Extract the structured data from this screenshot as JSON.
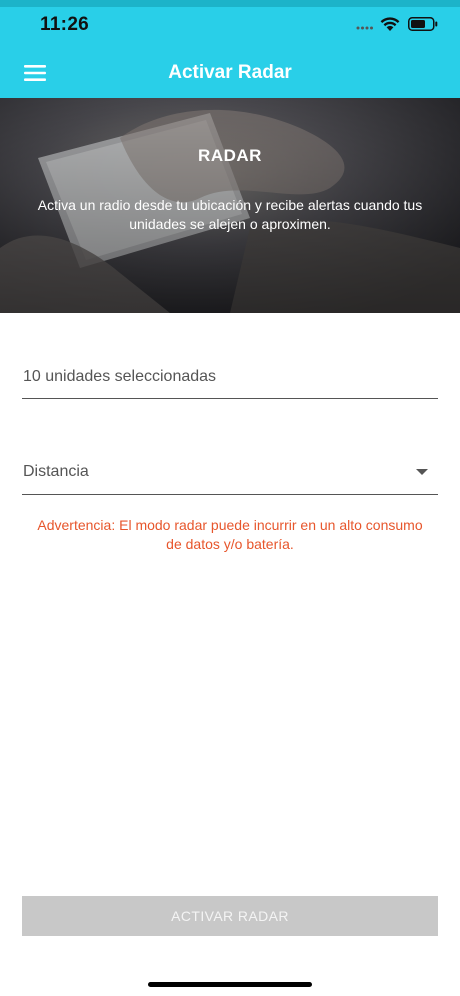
{
  "status_bar": {
    "time": "11:26"
  },
  "app_bar": {
    "menu_icon": "hamburger-icon",
    "title": "Activar Radar"
  },
  "hero": {
    "title": "RADAR",
    "description": "Activa un radio desde tu ubicación y recibe alertas cuando tus unidades se alejen o aproximen."
  },
  "form": {
    "units_value": "10 unidades seleccionadas",
    "distance_placeholder": "Distancia",
    "warning": "Advertencia: El modo radar puede incurrir en un alto consumo de datos y/o batería."
  },
  "actions": {
    "activate_label": "ACTIVAR RADAR"
  },
  "colors": {
    "primary": "#29cfe8",
    "warning": "#e7562c",
    "disabled_button": "#c8c8c8"
  }
}
